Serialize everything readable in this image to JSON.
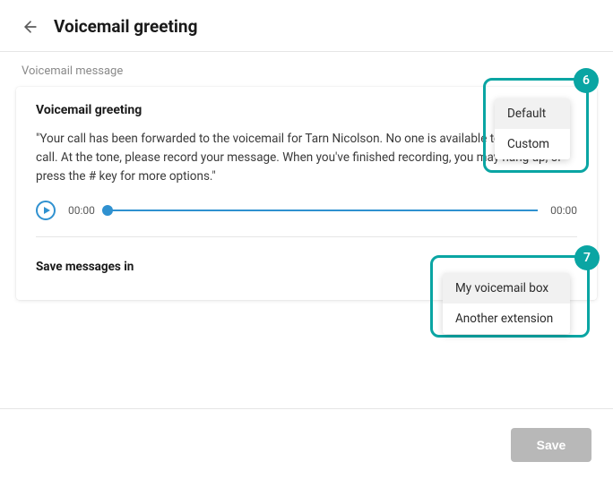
{
  "header": {
    "title": "Voicemail greeting"
  },
  "section": {
    "label": "Voicemail message"
  },
  "card": {
    "heading": "Voicemail greeting",
    "greeting_text": "\"Your call has been forwarded to the voicemail for Tarn Nicolson. No one is available to take your call. At the tone, please record your message. When you've finished recording, you may hang up, or press the # key for more options.\"",
    "player": {
      "elapsed": "00:00",
      "total": "00:00"
    },
    "save_label": "Save messages in"
  },
  "dropdowns": {
    "greeting": {
      "options": [
        "Default",
        "Custom"
      ],
      "selected": "Default"
    },
    "save_in": {
      "options": [
        "My voicemail box",
        "Another extension"
      ],
      "selected": "My voicemail box"
    }
  },
  "callouts": {
    "c6": "6",
    "c7": "7"
  },
  "footer": {
    "save_label": "Save"
  },
  "colors": {
    "accent_teal": "#0aa5a3",
    "player_blue": "#2f91d0",
    "disabled_gray": "#b8b8b8"
  }
}
